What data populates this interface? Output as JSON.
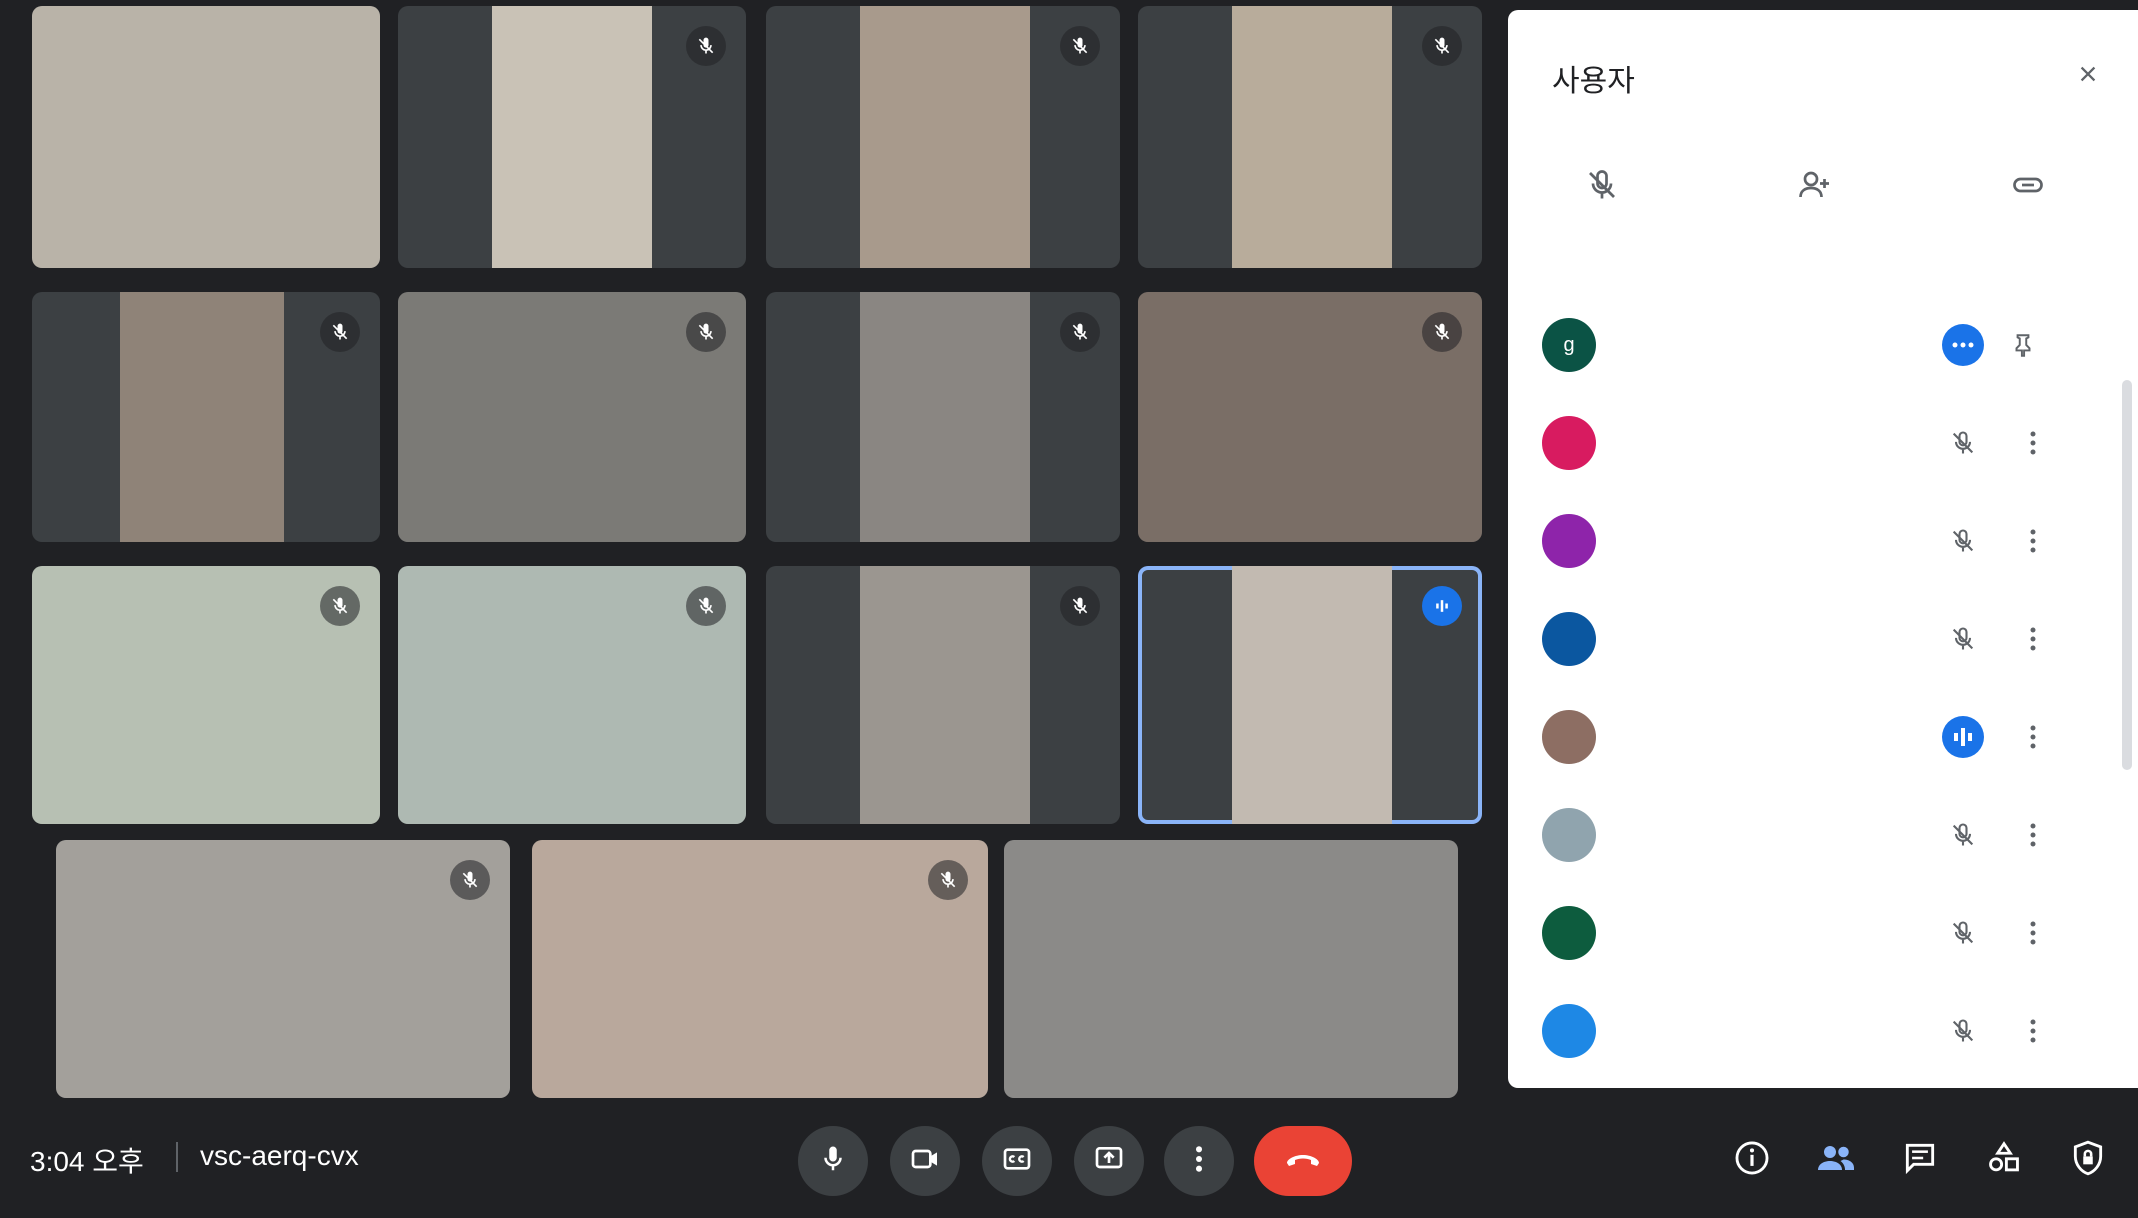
{
  "tiles": [
    {
      "name": "",
      "bg": "#b9b3a8"
    },
    {
      "name": "",
      "bg": "#c9c2b6"
    },
    {
      "name": "",
      "bg": "#a89a8c"
    },
    {
      "name": "",
      "bg": "#b8ac9b"
    },
    {
      "name": "",
      "bg": "#8f8378"
    },
    {
      "name": "",
      "bg": "#7b7a76"
    },
    {
      "name": "",
      "bg": "#8a8682"
    },
    {
      "name": "",
      "bg": "#7a6e66"
    },
    {
      "name": "",
      "bg": "#b7c0b3"
    },
    {
      "name": "",
      "bg": "#aeb9b2"
    },
    {
      "name": "",
      "bg": "#9b9690"
    },
    {
      "name": "",
      "bg": "#c2bab1"
    },
    {
      "name": "",
      "bg": "#a3a09b"
    },
    {
      "name": "",
      "bg": "#b9a89c"
    },
    {
      "name": "",
      "bg": "#8b8a88"
    }
  ],
  "panel": {
    "title": "사용자",
    "actions": [
      {
        "label": ""
      },
      {
        "label": ""
      },
      {
        "label": ""
      }
    ],
    "participants": [
      {
        "initials": "g",
        "color": "#0b5345",
        "name": "",
        "sub": "",
        "status": "presenting"
      },
      {
        "initials": "",
        "color": "#d81b60",
        "name": "",
        "sub": "",
        "status": "muted"
      },
      {
        "initials": "",
        "color": "#8e24aa",
        "name": "",
        "sub": "",
        "status": "muted"
      },
      {
        "initials": "",
        "color": "#0b57a0",
        "name": "",
        "sub": "",
        "status": "muted"
      },
      {
        "initials": "",
        "color": "#8d6e63",
        "name": "",
        "sub": "",
        "status": "speaking"
      },
      {
        "initials": "",
        "color": "#90a4ae",
        "name": "",
        "sub": "",
        "status": "muted"
      },
      {
        "initials": "",
        "color": "#0d5c3e",
        "name": "",
        "sub": "",
        "status": "muted"
      },
      {
        "initials": "",
        "color": "#1e88e5",
        "name": "",
        "sub": "",
        "status": "muted"
      }
    ]
  },
  "footer": {
    "time": "3:04 오후",
    "meeting_code": "vsc-aerq-cvx"
  },
  "colors": {
    "background": "#202124",
    "end_call": "#ea4335",
    "accent": "#1a73e8"
  }
}
